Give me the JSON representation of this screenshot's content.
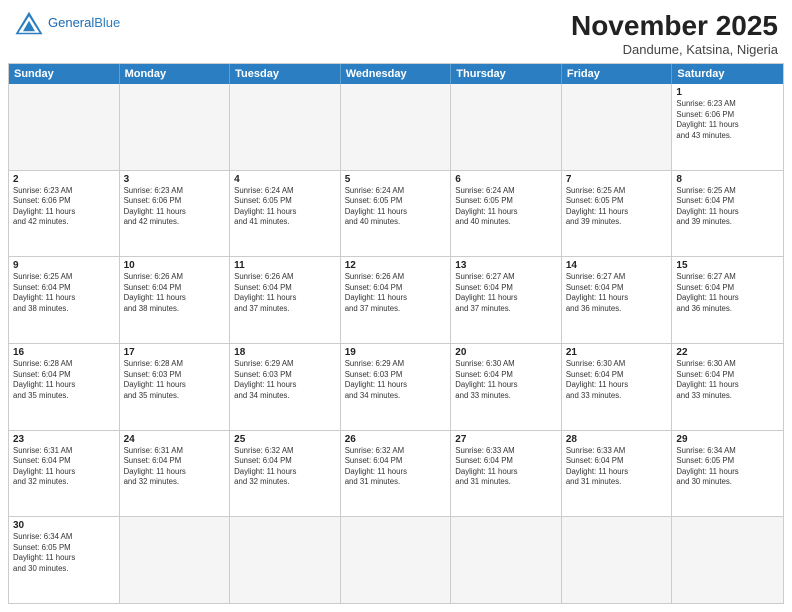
{
  "header": {
    "logo_general": "General",
    "logo_blue": "Blue",
    "month_title": "November 2025",
    "subtitle": "Dandume, Katsina, Nigeria"
  },
  "days_of_week": [
    "Sunday",
    "Monday",
    "Tuesday",
    "Wednesday",
    "Thursday",
    "Friday",
    "Saturday"
  ],
  "weeks": [
    [
      {
        "day": "",
        "text": "",
        "empty": true
      },
      {
        "day": "",
        "text": "",
        "empty": true
      },
      {
        "day": "",
        "text": "",
        "empty": true
      },
      {
        "day": "",
        "text": "",
        "empty": true
      },
      {
        "day": "",
        "text": "",
        "empty": true
      },
      {
        "day": "",
        "text": "",
        "empty": true
      },
      {
        "day": "1",
        "text": "Sunrise: 6:23 AM\nSunset: 6:06 PM\nDaylight: 11 hours\nand 43 minutes.",
        "empty": false
      }
    ],
    [
      {
        "day": "2",
        "text": "Sunrise: 6:23 AM\nSunset: 6:06 PM\nDaylight: 11 hours\nand 42 minutes.",
        "empty": false
      },
      {
        "day": "3",
        "text": "Sunrise: 6:23 AM\nSunset: 6:06 PM\nDaylight: 11 hours\nand 42 minutes.",
        "empty": false
      },
      {
        "day": "4",
        "text": "Sunrise: 6:24 AM\nSunset: 6:05 PM\nDaylight: 11 hours\nand 41 minutes.",
        "empty": false
      },
      {
        "day": "5",
        "text": "Sunrise: 6:24 AM\nSunset: 6:05 PM\nDaylight: 11 hours\nand 40 minutes.",
        "empty": false
      },
      {
        "day": "6",
        "text": "Sunrise: 6:24 AM\nSunset: 6:05 PM\nDaylight: 11 hours\nand 40 minutes.",
        "empty": false
      },
      {
        "day": "7",
        "text": "Sunrise: 6:25 AM\nSunset: 6:05 PM\nDaylight: 11 hours\nand 39 minutes.",
        "empty": false
      },
      {
        "day": "8",
        "text": "Sunrise: 6:25 AM\nSunset: 6:04 PM\nDaylight: 11 hours\nand 39 minutes.",
        "empty": false
      }
    ],
    [
      {
        "day": "9",
        "text": "Sunrise: 6:25 AM\nSunset: 6:04 PM\nDaylight: 11 hours\nand 38 minutes.",
        "empty": false
      },
      {
        "day": "10",
        "text": "Sunrise: 6:26 AM\nSunset: 6:04 PM\nDaylight: 11 hours\nand 38 minutes.",
        "empty": false
      },
      {
        "day": "11",
        "text": "Sunrise: 6:26 AM\nSunset: 6:04 PM\nDaylight: 11 hours\nand 37 minutes.",
        "empty": false
      },
      {
        "day": "12",
        "text": "Sunrise: 6:26 AM\nSunset: 6:04 PM\nDaylight: 11 hours\nand 37 minutes.",
        "empty": false
      },
      {
        "day": "13",
        "text": "Sunrise: 6:27 AM\nSunset: 6:04 PM\nDaylight: 11 hours\nand 37 minutes.",
        "empty": false
      },
      {
        "day": "14",
        "text": "Sunrise: 6:27 AM\nSunset: 6:04 PM\nDaylight: 11 hours\nand 36 minutes.",
        "empty": false
      },
      {
        "day": "15",
        "text": "Sunrise: 6:27 AM\nSunset: 6:04 PM\nDaylight: 11 hours\nand 36 minutes.",
        "empty": false
      }
    ],
    [
      {
        "day": "16",
        "text": "Sunrise: 6:28 AM\nSunset: 6:04 PM\nDaylight: 11 hours\nand 35 minutes.",
        "empty": false
      },
      {
        "day": "17",
        "text": "Sunrise: 6:28 AM\nSunset: 6:03 PM\nDaylight: 11 hours\nand 35 minutes.",
        "empty": false
      },
      {
        "day": "18",
        "text": "Sunrise: 6:29 AM\nSunset: 6:03 PM\nDaylight: 11 hours\nand 34 minutes.",
        "empty": false
      },
      {
        "day": "19",
        "text": "Sunrise: 6:29 AM\nSunset: 6:03 PM\nDaylight: 11 hours\nand 34 minutes.",
        "empty": false
      },
      {
        "day": "20",
        "text": "Sunrise: 6:30 AM\nSunset: 6:04 PM\nDaylight: 11 hours\nand 33 minutes.",
        "empty": false
      },
      {
        "day": "21",
        "text": "Sunrise: 6:30 AM\nSunset: 6:04 PM\nDaylight: 11 hours\nand 33 minutes.",
        "empty": false
      },
      {
        "day": "22",
        "text": "Sunrise: 6:30 AM\nSunset: 6:04 PM\nDaylight: 11 hours\nand 33 minutes.",
        "empty": false
      }
    ],
    [
      {
        "day": "23",
        "text": "Sunrise: 6:31 AM\nSunset: 6:04 PM\nDaylight: 11 hours\nand 32 minutes.",
        "empty": false
      },
      {
        "day": "24",
        "text": "Sunrise: 6:31 AM\nSunset: 6:04 PM\nDaylight: 11 hours\nand 32 minutes.",
        "empty": false
      },
      {
        "day": "25",
        "text": "Sunrise: 6:32 AM\nSunset: 6:04 PM\nDaylight: 11 hours\nand 32 minutes.",
        "empty": false
      },
      {
        "day": "26",
        "text": "Sunrise: 6:32 AM\nSunset: 6:04 PM\nDaylight: 11 hours\nand 31 minutes.",
        "empty": false
      },
      {
        "day": "27",
        "text": "Sunrise: 6:33 AM\nSunset: 6:04 PM\nDaylight: 11 hours\nand 31 minutes.",
        "empty": false
      },
      {
        "day": "28",
        "text": "Sunrise: 6:33 AM\nSunset: 6:04 PM\nDaylight: 11 hours\nand 31 minutes.",
        "empty": false
      },
      {
        "day": "29",
        "text": "Sunrise: 6:34 AM\nSunset: 6:05 PM\nDaylight: 11 hours\nand 30 minutes.",
        "empty": false
      }
    ],
    [
      {
        "day": "30",
        "text": "Sunrise: 6:34 AM\nSunset: 6:05 PM\nDaylight: 11 hours\nand 30 minutes.",
        "empty": false
      },
      {
        "day": "",
        "text": "",
        "empty": true
      },
      {
        "day": "",
        "text": "",
        "empty": true
      },
      {
        "day": "",
        "text": "",
        "empty": true
      },
      {
        "day": "",
        "text": "",
        "empty": true
      },
      {
        "day": "",
        "text": "",
        "empty": true
      },
      {
        "day": "",
        "text": "",
        "empty": true
      }
    ]
  ]
}
